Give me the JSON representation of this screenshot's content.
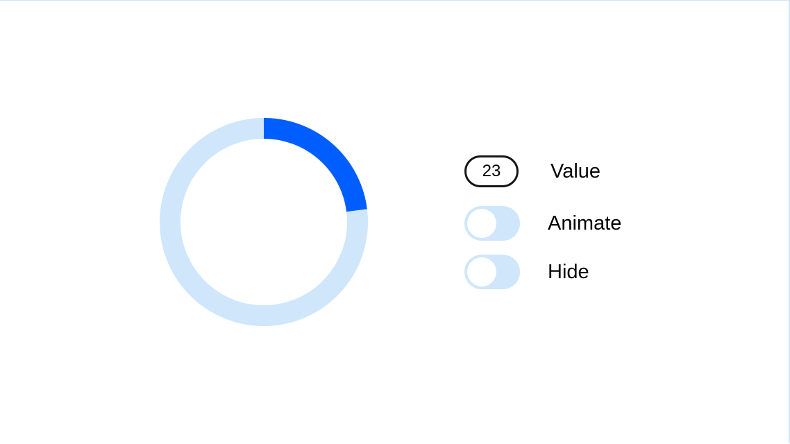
{
  "colors": {
    "track": "#cfe6fb",
    "progress": "#005eff",
    "input_border": "#161616",
    "frame_border": "#cfe6fb"
  },
  "progress": {
    "value": 23,
    "max": 100
  },
  "controls": {
    "value_input": {
      "value": "23",
      "label": "Value"
    },
    "animate": {
      "label": "Animate",
      "on": false
    },
    "hide": {
      "label": "Hide",
      "on": false
    }
  }
}
